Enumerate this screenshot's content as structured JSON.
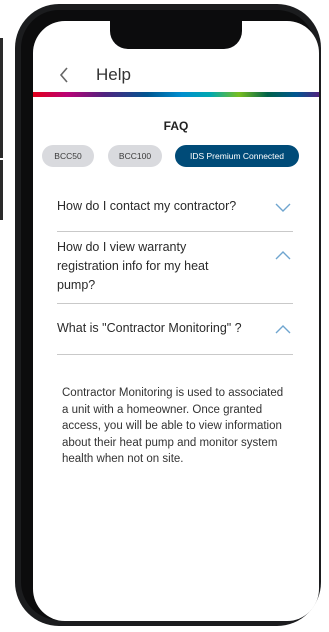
{
  "header": {
    "back_icon": "chevron-left-icon",
    "title": "Help"
  },
  "brand_stripe_colors": [
    "#e2001a",
    "#b90276",
    "#50237f",
    "#005691",
    "#008ecf",
    "#00a8b0",
    "#78be20",
    "#006249"
  ],
  "faq": {
    "title": "FAQ",
    "tabs": [
      {
        "label": "BCC50",
        "active": false
      },
      {
        "label": "BCC100",
        "active": false
      },
      {
        "label": "IDS Premium Connected",
        "active": true
      }
    ],
    "items": [
      {
        "question": "How do I contact my contractor?",
        "expanded": false,
        "icon": "chevron-down-icon"
      },
      {
        "question": "How do I view warranty registration info for my heat pump?",
        "expanded": true,
        "icon": "chevron-up-icon"
      },
      {
        "question": "What is \"Contractor Monitoring\" ?",
        "expanded": true,
        "icon": "chevron-up-icon"
      }
    ],
    "answer": "Contractor Monitoring is used to associated a unit with a homeowner. Once granted access, you will be able to view information about their heat pump and monitor system health when not on site."
  },
  "colors": {
    "active_tab": "#004b78",
    "chevron": "#6fa5cf",
    "accent_red": "#e2001a"
  }
}
